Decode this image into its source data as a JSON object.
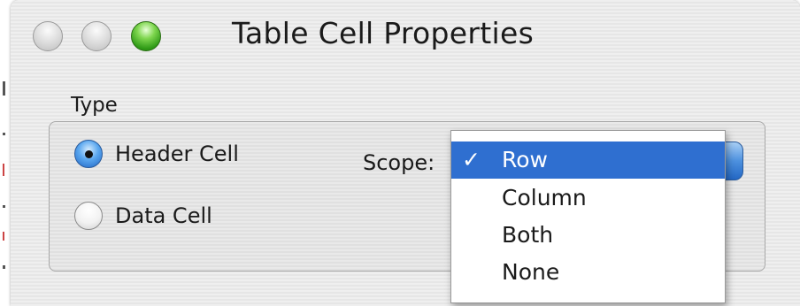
{
  "window": {
    "title": "Table Cell Properties"
  },
  "type_group": {
    "label": "Type",
    "options": [
      {
        "label": "Header Cell",
        "selected": true
      },
      {
        "label": "Data Cell",
        "selected": false
      }
    ]
  },
  "scope": {
    "label": "Scope:",
    "selected_value": "Row",
    "menu": {
      "check_glyph": "✓",
      "items": [
        {
          "label": "Row",
          "checked": true
        },
        {
          "label": "Column",
          "checked": false
        },
        {
          "label": "Both",
          "checked": false
        },
        {
          "label": "None",
          "checked": false
        }
      ]
    }
  },
  "colors": {
    "menu_highlight": "#2f6fd0",
    "zoom_button": "#3fae1c",
    "radio_selected": "#3d8ce0"
  },
  "icons": {
    "close": "close-icon",
    "minimize": "minimize-icon",
    "zoom": "zoom-icon",
    "check": "checkmark-icon"
  }
}
